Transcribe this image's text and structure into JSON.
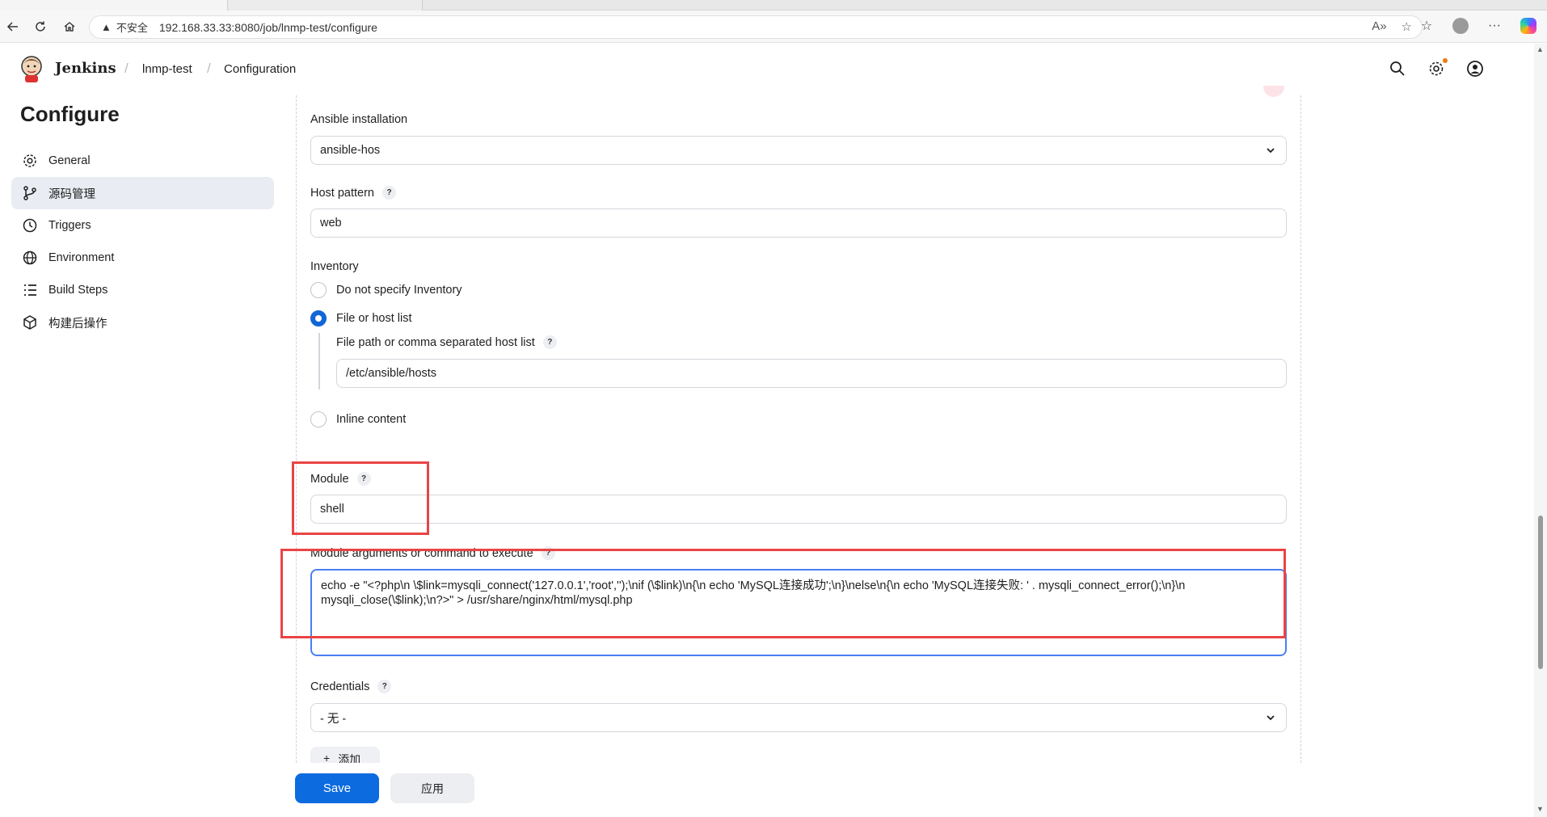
{
  "browser": {
    "address_warning": "不安全",
    "url": "192.168.33.33:8080/job/lnmp-test/configure"
  },
  "header": {
    "brand": "Jenkins",
    "breadcrumbs": [
      "lnmp-test",
      "Configuration"
    ]
  },
  "sidebar": {
    "title": "Configure",
    "items": [
      {
        "label": "General",
        "icon": "gear-icon"
      },
      {
        "label": "源码管理",
        "icon": "source-branch-icon"
      },
      {
        "label": "Triggers",
        "icon": "clock-icon"
      },
      {
        "label": "Environment",
        "icon": "globe-icon"
      },
      {
        "label": "Build Steps",
        "icon": "list-icon"
      },
      {
        "label": "构建后操作",
        "icon": "package-icon"
      }
    ],
    "active_index": 1
  },
  "form": {
    "ansible_installation": {
      "label": "Ansible installation",
      "value": "ansible-hos"
    },
    "host_pattern": {
      "label": "Host pattern",
      "value": "web"
    },
    "inventory": {
      "label": "Inventory",
      "options": [
        "Do not specify Inventory",
        "File or host list",
        "Inline content"
      ],
      "selected": "File or host list",
      "file_path_label": "File path or comma separated host list",
      "file_path_value": "/etc/ansible/hosts"
    },
    "module": {
      "label": "Module",
      "value": "shell"
    },
    "module_args": {
      "label": "Module arguments or command to execute",
      "value": "echo -e \"<?php\\n \\$link=mysqli_connect('127.0.0.1','root','');\\nif (\\$link)\\n{\\n echo 'MySQL连接成功';\\n}\\nelse\\n{\\n echo 'MySQL连接失败: ' . mysqli_connect_error();\\n}\\n mysqli_close(\\$link);\\n?>\" > /usr/share/nginx/html/mysql.php"
    },
    "credentials": {
      "label": "Credentials",
      "value": "- 无 -"
    },
    "add_button": "添加",
    "help_glyph": "?"
  },
  "actions": {
    "save": "Save",
    "apply": "应用"
  },
  "colors": {
    "primary": "#0b6bdf",
    "highlight": "#ea4444",
    "focus": "#4a7ff0"
  }
}
